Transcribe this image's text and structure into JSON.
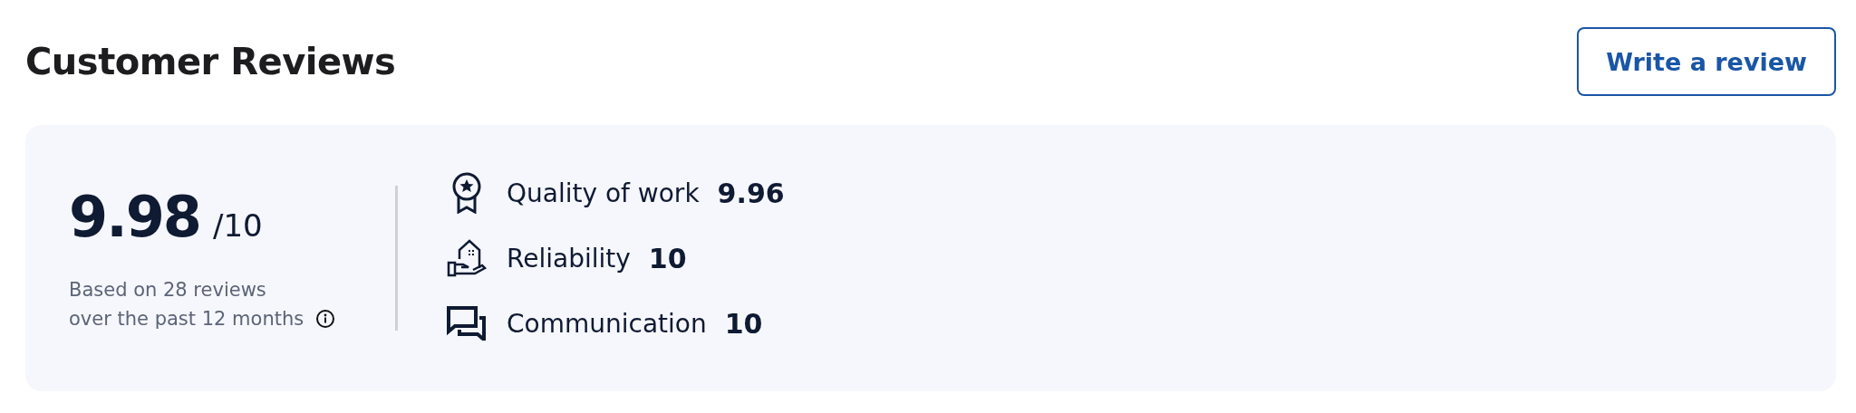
{
  "title": "Customer Reviews",
  "write_button": "Write a review",
  "summary": {
    "score": "9.98",
    "scale": "/10",
    "note": "Based on 28 reviews over the past 12 months"
  },
  "criteria": [
    {
      "kind": "award",
      "label": "Quality of work",
      "score": "9.96"
    },
    {
      "kind": "house",
      "label": "Reliability",
      "score": "10"
    },
    {
      "kind": "chat",
      "label": "Communication",
      "score": "10"
    }
  ]
}
